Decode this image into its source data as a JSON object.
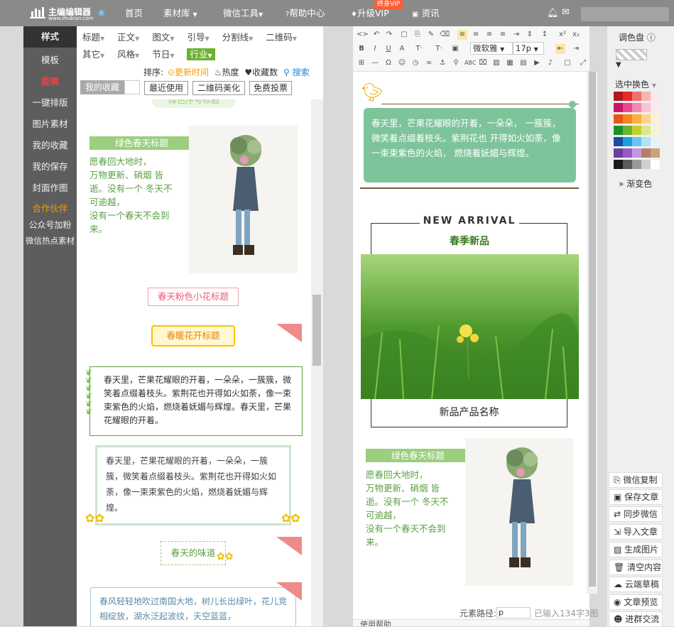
{
  "brand": {
    "name": "主编编辑器",
    "url": "www.zhubian.com"
  },
  "topnav": {
    "home": "首页",
    "library": "素材库",
    "wechat_tools": "微信工具",
    "help": "帮助中心",
    "upgrade": "升级VIP",
    "vip_badge": "终身VIP",
    "news": "资讯"
  },
  "sidebar": {
    "items": [
      "样式",
      "模板",
      "疫情",
      "一键排版",
      "图片素材",
      "我的收藏",
      "我的保存",
      "封面作图",
      "合作伙伴",
      "公众号加粉",
      "微信热点素材"
    ]
  },
  "category_tabs": {
    "row1": [
      "标题",
      "正文",
      "图文",
      "引导",
      "分割线",
      "二维码"
    ],
    "row2": [
      "其它",
      "风格",
      "节日"
    ],
    "active": "行业"
  },
  "sort": {
    "label": "排序:",
    "update_time": "更新时间",
    "heat": "热度",
    "favorites": "收藏数",
    "search": "搜索"
  },
  "filter_buttons": {
    "my_favorites": "我的收藏",
    "recent": "最近使用",
    "qrcode": "二维码美化",
    "free": "免费投票"
  },
  "templates": {
    "partial_title": "绿色序号标题",
    "green_title": "绿色春天标题",
    "poem_lines": [
      "愿春回大地时，",
      "万物更新、硝烟 皆",
      "逝。没有一个 冬天不",
      "可逾越，",
      "没有一个春天不会到",
      "来。"
    ],
    "pink_title": "春天粉色小花标题",
    "yellow_title": "春暖花开标题",
    "box1_text": "春天里，芒果花耀眼的开着，一朵朵，一簇簇，微笑着点缀着枝头。紫荆花也开得如火如荼，像一束束紫色的火焰，燃烧着妩媚与辉煌。春天里，芒果花耀眼的开着。",
    "box2_text": "春天里，芒果花耀眼的开着，一朵朵，一簇簇，微笑着点缀着枝头。紫荆花也开得如火如荼，像一束束紫色的火焰，燃烧着妩媚与辉煌。",
    "dashed_title": "春天的味道",
    "box3_text": "春风轻轻地吹过南国大地，树儿长出绿叶，花儿竞相绽放，湖水泛起波纹，天空蓝蓝，"
  },
  "editor": {
    "font_name": "微软雅",
    "font_size": "17p",
    "green_box_text": "春天里，芒果花耀眼的开着，一朵朵， 一簇簇，微笑着点缀着枝头。紫荆花也 开得如火如荼，像一束束紫色的火焰， 燃烧着妩媚与辉煌。",
    "new_arrival": "NEW ARRIVAL",
    "spring_new": "春季新品",
    "product_name": "新品产品名称",
    "green_title": "绿色春天标题",
    "poem_lines": [
      "愿春回大地时，",
      "万物更新、硝烟 皆",
      "逝。没有一个 冬天不",
      "可逾越，",
      "没有一个春天不会到",
      "来。"
    ],
    "path_label": "元素路径:",
    "path_value": "p",
    "count": "已输入134字3图",
    "bottom_text": "使用帮助"
  },
  "palette": {
    "title": "调色盘",
    "select_color": "选中换色",
    "gradient": "渐变色",
    "colors": [
      [
        "#b0191c",
        "#e52a28",
        "#f07070",
        "#f6b6b0",
        "#fde6e4"
      ],
      [
        "#c4176c",
        "#e64a8c",
        "#f08ab0",
        "#f8c4d6",
        "#fde8f0"
      ],
      [
        "#e4581c",
        "#f6851f",
        "#fbb03b",
        "#fdd28b",
        "#fef0d7"
      ],
      [
        "#1e8f24",
        "#6ab42d",
        "#c1d22d",
        "#dfe78c",
        "#f3f6d5"
      ],
      [
        "#1a4fa0",
        "#1c9ee0",
        "#68c6f0",
        "#b3e2f8",
        "#e4f4fc"
      ],
      [
        "#6b3fa0",
        "#9a59c8",
        "#c796e0",
        "#b37e6a",
        "#c9a27e"
      ],
      [
        "#1a1a1a",
        "#5a5a5a",
        "#9a9a9a",
        "#cfcfcf",
        "#ffffff"
      ]
    ]
  },
  "actions": [
    "微信复制",
    "保存文章",
    "同步微信",
    "导入文章",
    "生成图片",
    "清空内容",
    "云端草稿",
    "文章预览",
    "进群交流"
  ],
  "accent": {
    "green": "#9bcf7f",
    "box_green": "#7dc49a",
    "orange": "#f59b00",
    "blue": "#1a8ce0",
    "red": "#e4000b"
  }
}
